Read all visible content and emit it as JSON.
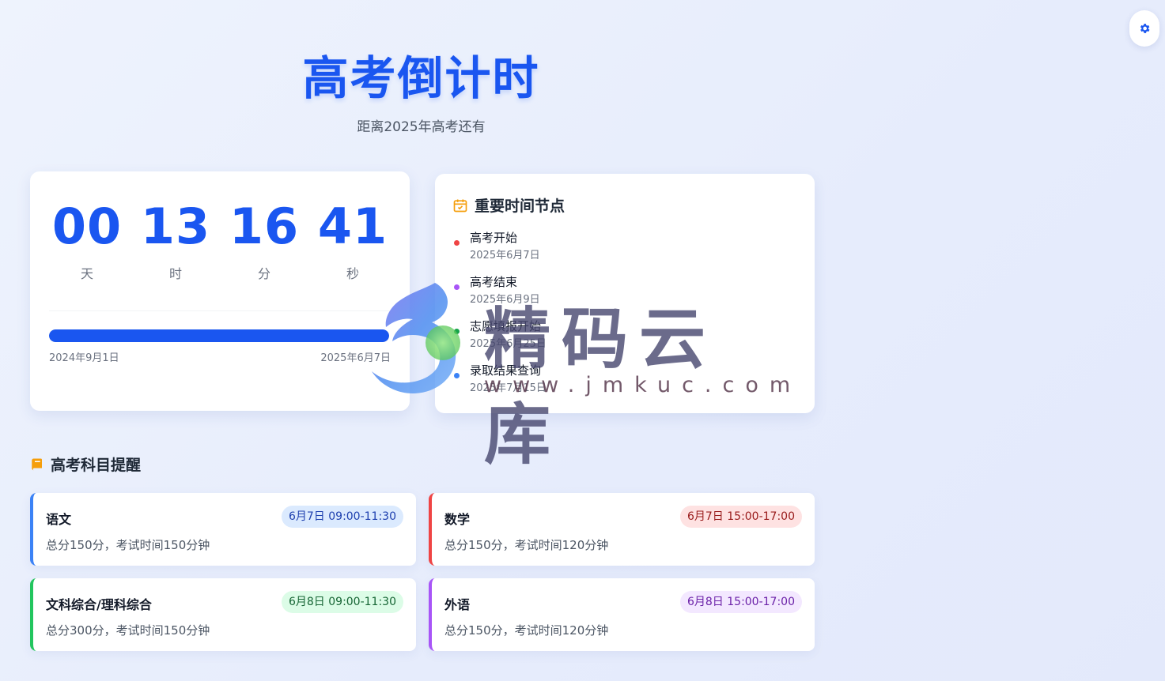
{
  "header": {
    "title": "高考倒计时",
    "subtitle": "距离2025年高考还有"
  },
  "countdown": {
    "days": "00",
    "hours": "13",
    "minutes": "16",
    "seconds": "41",
    "labels": {
      "days": "天",
      "hours": "时",
      "minutes": "分",
      "seconds": "秒"
    },
    "progress": {
      "percent": 100,
      "start_label": "2024年9月1日",
      "end_label": "2025年6月7日"
    }
  },
  "timeline": {
    "title": "重要时间节点",
    "icon": "calendar-check-icon",
    "items": [
      {
        "name": "高考开始",
        "date": "2025年6月7日",
        "color": "#ef4444"
      },
      {
        "name": "高考结束",
        "date": "2025年6月9日",
        "color": "#a855f7"
      },
      {
        "name": "志愿填报开始",
        "date": "2025年6月25日",
        "color": "#16a34a"
      },
      {
        "name": "录取结果查询",
        "date": "2025年7月15日",
        "color": "#3b82f6"
      }
    ]
  },
  "subjects_section": {
    "title": "高考科目提醒",
    "icon": "book-icon",
    "subjects": [
      {
        "name": "语文",
        "time": "6月7日 09:00-11:30",
        "desc": "总分150分，考试时间150分钟",
        "accent": "#3b82f6",
        "badge_bg": "#dbeafe",
        "badge_fg": "#1e40af"
      },
      {
        "name": "数学",
        "time": "6月7日 15:00-17:00",
        "desc": "总分150分，考试时间120分钟",
        "accent": "#ef4444",
        "badge_bg": "#fee2e2",
        "badge_fg": "#991b1b"
      },
      {
        "name": "文科综合/理科综合",
        "time": "6月8日 09:00-11:30",
        "desc": "总分300分，考试时间150分钟",
        "accent": "#22c55e",
        "badge_bg": "#dcfce7",
        "badge_fg": "#166534"
      },
      {
        "name": "外语",
        "time": "6月8日 15:00-17:00",
        "desc": "总分150分，考试时间120分钟",
        "accent": "#a855f7",
        "badge_bg": "#f3e8ff",
        "badge_fg": "#6b21a8"
      }
    ]
  },
  "settings": {
    "icon": "gear-icon"
  },
  "watermark": {
    "text": "精码云库",
    "url": "www.jmkuc.com"
  },
  "colors": {
    "primary": "#1a56f0",
    "accent_orange": "#f59e0b"
  }
}
